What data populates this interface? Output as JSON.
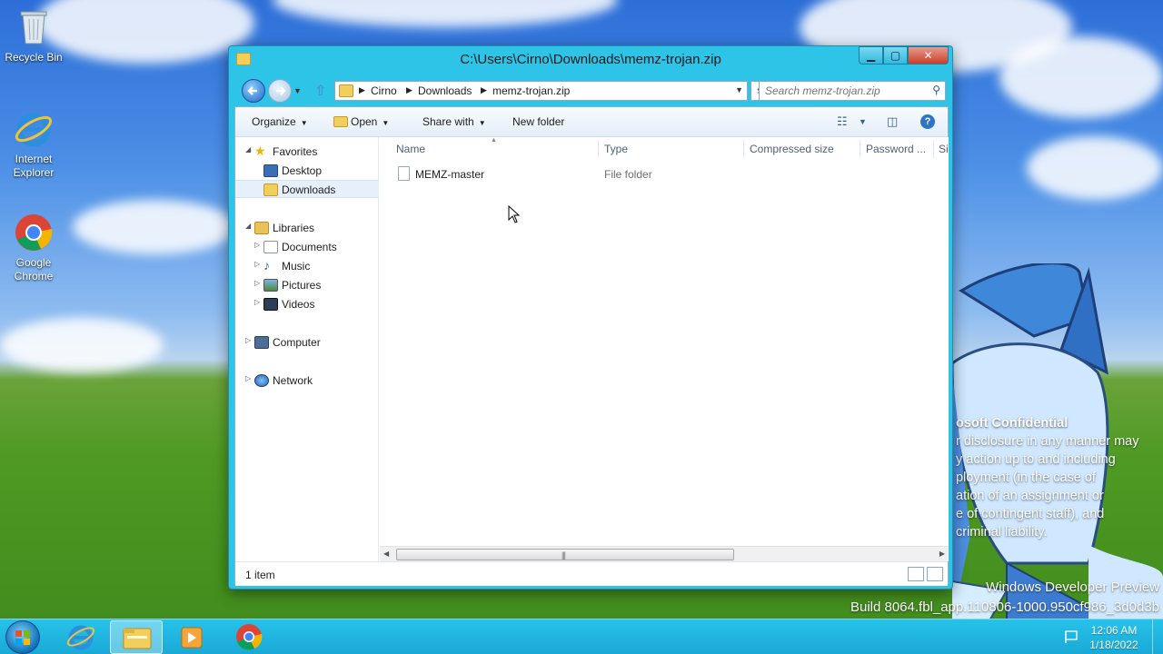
{
  "desktop": {
    "icons": [
      {
        "label": "Recycle Bin",
        "icon": "recycle-bin-icon"
      },
      {
        "label": "Internet Explorer",
        "icon": "internet-explorer-icon"
      },
      {
        "label": "Google Chrome",
        "icon": "chrome-icon"
      }
    ],
    "watermark": {
      "heading": "osoft Confidential",
      "lines": [
        "r disclosure in any manner may",
        "y action up to and including",
        "ployment (in the case of",
        "ation of an assignment or",
        "e of contingent staff), and",
        "criminal liability."
      ],
      "build_line1": "Windows Developer Preview",
      "build_line2": "Build 8064.fbl_app.110806-1000.950cf986_3d0d3b"
    }
  },
  "window": {
    "title": "C:\\Users\\Cirno\\Downloads\\memz-trojan.zip",
    "controls": {
      "minimize": "▁",
      "maximize": "▢",
      "close": "✕"
    },
    "address": {
      "crumbs": [
        "Cirno",
        "Downloads",
        "memz-trojan.zip"
      ]
    },
    "search": {
      "placeholder": "Search memz-trojan.zip"
    },
    "toolbar": {
      "organize": "Organize",
      "open": "Open",
      "share_with": "Share with",
      "new_folder": "New folder"
    },
    "nav": {
      "favorites": "Favorites",
      "desktop": "Desktop",
      "downloads": "Downloads",
      "libraries": "Libraries",
      "documents": "Documents",
      "music": "Music",
      "pictures": "Pictures",
      "videos": "Videos",
      "computer": "Computer",
      "network": "Network"
    },
    "columns": {
      "name": "Name",
      "type": "Type",
      "compressed_size": "Compressed size",
      "password": "Password ...",
      "overflow": "Si"
    },
    "files": [
      {
        "name": "MEMZ-master",
        "type": "File folder"
      }
    ],
    "status": {
      "count": "1 item"
    }
  },
  "taskbar": {
    "clock_time": "12:06 AM",
    "clock_date": "1/18/2022"
  },
  "colors": {
    "window_frame": "#2ec4e8",
    "taskbar": "#1fb4e0",
    "accent": "#2d74c9"
  }
}
